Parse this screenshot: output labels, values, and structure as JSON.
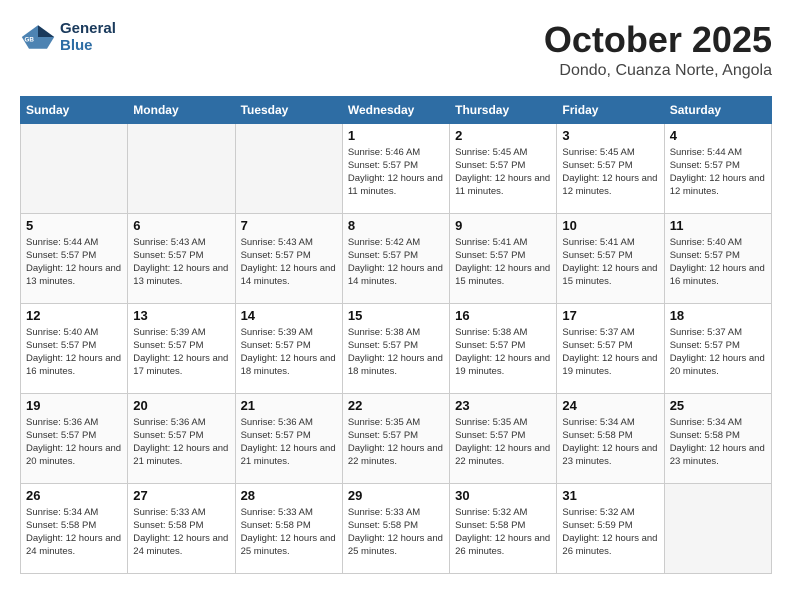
{
  "header": {
    "logo_line1": "General",
    "logo_line2": "Blue",
    "month": "October 2025",
    "location": "Dondo, Cuanza Norte, Angola"
  },
  "weekdays": [
    "Sunday",
    "Monday",
    "Tuesday",
    "Wednesday",
    "Thursday",
    "Friday",
    "Saturday"
  ],
  "weeks": [
    [
      {
        "day": "",
        "empty": true
      },
      {
        "day": "",
        "empty": true
      },
      {
        "day": "",
        "empty": true
      },
      {
        "day": "1",
        "sunrise": "5:46 AM",
        "sunset": "5:57 PM",
        "daylight": "12 hours and 11 minutes."
      },
      {
        "day": "2",
        "sunrise": "5:45 AM",
        "sunset": "5:57 PM",
        "daylight": "12 hours and 11 minutes."
      },
      {
        "day": "3",
        "sunrise": "5:45 AM",
        "sunset": "5:57 PM",
        "daylight": "12 hours and 12 minutes."
      },
      {
        "day": "4",
        "sunrise": "5:44 AM",
        "sunset": "5:57 PM",
        "daylight": "12 hours and 12 minutes."
      }
    ],
    [
      {
        "day": "5",
        "sunrise": "5:44 AM",
        "sunset": "5:57 PM",
        "daylight": "12 hours and 13 minutes."
      },
      {
        "day": "6",
        "sunrise": "5:43 AM",
        "sunset": "5:57 PM",
        "daylight": "12 hours and 13 minutes."
      },
      {
        "day": "7",
        "sunrise": "5:43 AM",
        "sunset": "5:57 PM",
        "daylight": "12 hours and 14 minutes."
      },
      {
        "day": "8",
        "sunrise": "5:42 AM",
        "sunset": "5:57 PM",
        "daylight": "12 hours and 14 minutes."
      },
      {
        "day": "9",
        "sunrise": "5:41 AM",
        "sunset": "5:57 PM",
        "daylight": "12 hours and 15 minutes."
      },
      {
        "day": "10",
        "sunrise": "5:41 AM",
        "sunset": "5:57 PM",
        "daylight": "12 hours and 15 minutes."
      },
      {
        "day": "11",
        "sunrise": "5:40 AM",
        "sunset": "5:57 PM",
        "daylight": "12 hours and 16 minutes."
      }
    ],
    [
      {
        "day": "12",
        "sunrise": "5:40 AM",
        "sunset": "5:57 PM",
        "daylight": "12 hours and 16 minutes."
      },
      {
        "day": "13",
        "sunrise": "5:39 AM",
        "sunset": "5:57 PM",
        "daylight": "12 hours and 17 minutes."
      },
      {
        "day": "14",
        "sunrise": "5:39 AM",
        "sunset": "5:57 PM",
        "daylight": "12 hours and 18 minutes."
      },
      {
        "day": "15",
        "sunrise": "5:38 AM",
        "sunset": "5:57 PM",
        "daylight": "12 hours and 18 minutes."
      },
      {
        "day": "16",
        "sunrise": "5:38 AM",
        "sunset": "5:57 PM",
        "daylight": "12 hours and 19 minutes."
      },
      {
        "day": "17",
        "sunrise": "5:37 AM",
        "sunset": "5:57 PM",
        "daylight": "12 hours and 19 minutes."
      },
      {
        "day": "18",
        "sunrise": "5:37 AM",
        "sunset": "5:57 PM",
        "daylight": "12 hours and 20 minutes."
      }
    ],
    [
      {
        "day": "19",
        "sunrise": "5:36 AM",
        "sunset": "5:57 PM",
        "daylight": "12 hours and 20 minutes."
      },
      {
        "day": "20",
        "sunrise": "5:36 AM",
        "sunset": "5:57 PM",
        "daylight": "12 hours and 21 minutes."
      },
      {
        "day": "21",
        "sunrise": "5:36 AM",
        "sunset": "5:57 PM",
        "daylight": "12 hours and 21 minutes."
      },
      {
        "day": "22",
        "sunrise": "5:35 AM",
        "sunset": "5:57 PM",
        "daylight": "12 hours and 22 minutes."
      },
      {
        "day": "23",
        "sunrise": "5:35 AM",
        "sunset": "5:57 PM",
        "daylight": "12 hours and 22 minutes."
      },
      {
        "day": "24",
        "sunrise": "5:34 AM",
        "sunset": "5:58 PM",
        "daylight": "12 hours and 23 minutes."
      },
      {
        "day": "25",
        "sunrise": "5:34 AM",
        "sunset": "5:58 PM",
        "daylight": "12 hours and 23 minutes."
      }
    ],
    [
      {
        "day": "26",
        "sunrise": "5:34 AM",
        "sunset": "5:58 PM",
        "daylight": "12 hours and 24 minutes."
      },
      {
        "day": "27",
        "sunrise": "5:33 AM",
        "sunset": "5:58 PM",
        "daylight": "12 hours and 24 minutes."
      },
      {
        "day": "28",
        "sunrise": "5:33 AM",
        "sunset": "5:58 PM",
        "daylight": "12 hours and 25 minutes."
      },
      {
        "day": "29",
        "sunrise": "5:33 AM",
        "sunset": "5:58 PM",
        "daylight": "12 hours and 25 minutes."
      },
      {
        "day": "30",
        "sunrise": "5:32 AM",
        "sunset": "5:58 PM",
        "daylight": "12 hours and 26 minutes."
      },
      {
        "day": "31",
        "sunrise": "5:32 AM",
        "sunset": "5:59 PM",
        "daylight": "12 hours and 26 minutes."
      },
      {
        "day": "",
        "empty": true
      }
    ]
  ],
  "labels": {
    "sunrise": "Sunrise:",
    "sunset": "Sunset:",
    "daylight": "Daylight:"
  }
}
